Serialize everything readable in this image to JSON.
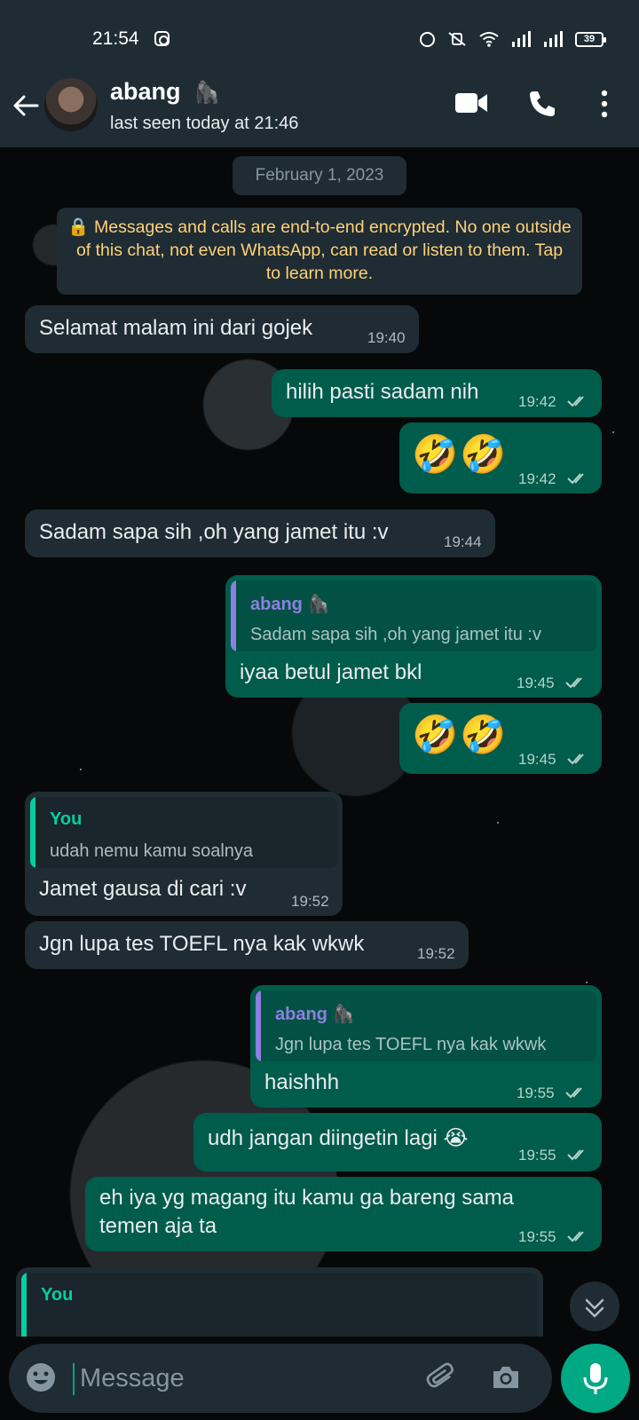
{
  "status_bar": {
    "time": "21:54",
    "battery": "39"
  },
  "header": {
    "contact_name": "abang",
    "name_emoji": "🦍",
    "last_seen": "last seen today at 21:46"
  },
  "chat": {
    "date_chip": "February 1, 2023",
    "encryption_notice": "🔒 Messages and calls are end-to-end encrypted. No one outside of this chat, not even WhatsApp, can read or listen to them. Tap to learn more.",
    "messages": [
      {
        "text": "Selamat malam ini dari gojek",
        "time": "19:40"
      },
      {
        "text": "hilih pasti sadam nih",
        "time": "19:42"
      },
      {
        "text": "🤣🤣",
        "time": "19:42"
      },
      {
        "text": "Sadam sapa sih ,oh yang jamet itu :v",
        "time": "19:44"
      },
      {
        "quote_name": "abang 🦍",
        "quote_text": "Sadam sapa sih ,oh yang jamet itu :v",
        "text": "iyaa betul jamet bkl",
        "time": "19:45"
      },
      {
        "text": "🤣🤣",
        "time": "19:45"
      },
      {
        "quote_name": "You",
        "quote_text": "udah nemu kamu soalnya",
        "text": "Jamet gausa di cari :v",
        "time": "19:52"
      },
      {
        "text": "Jgn lupa tes TOEFL nya kak wkwk",
        "time": "19:52"
      },
      {
        "quote_name": "abang 🦍",
        "quote_text": "Jgn lupa tes TOEFL nya kak wkwk",
        "text": "haishhh",
        "time": "19:55"
      },
      {
        "text": "udh jangan diingetin lagi 😭",
        "time": "19:55"
      },
      {
        "text_line1": "eh iya yg magang itu kamu ga bareng sama",
        "text_line2": "temen aja ta",
        "time": "19:55"
      },
      {
        "quote_name": "You"
      }
    ]
  },
  "composer": {
    "placeholder": "Message"
  },
  "colors": {
    "header_bg": "#1f2c34",
    "incoming_bubble": "#1f2c34",
    "outgoing_bubble": "#005c4b",
    "accent": "#00a884",
    "quote_you": "#06cf9c",
    "quote_contact": "#8e7fe0",
    "notice_text": "#ffd279"
  }
}
